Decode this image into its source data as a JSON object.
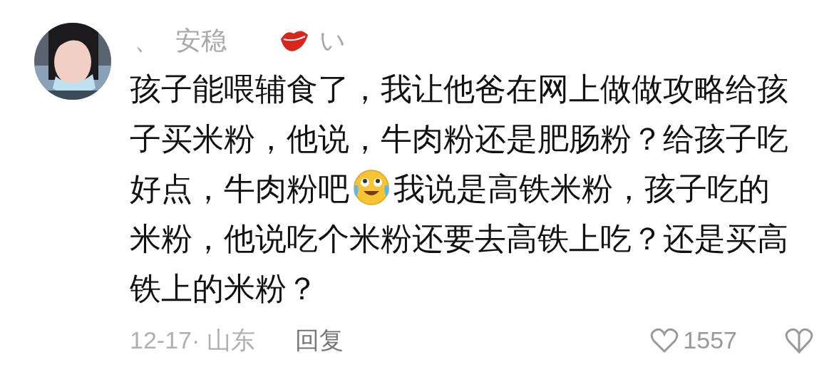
{
  "comment": {
    "username": {
      "prefix": "、",
      "name": "安稳",
      "suffix": "い"
    },
    "body": {
      "before_emoji": "孩子能喂辅食了，我让他爸在网上做做攻略给孩子买米粉，他说，牛肉粉还是肥肠粉？给孩子吃好点，牛肉粉吧",
      "after_emoji": "我说是高铁米粉，孩子吃的米粉，他说吃个米粉还要去高铁上吃？还是买高铁上的米粉？"
    },
    "meta": "12-17· 山东",
    "reply": "回复",
    "likes": "1557"
  }
}
